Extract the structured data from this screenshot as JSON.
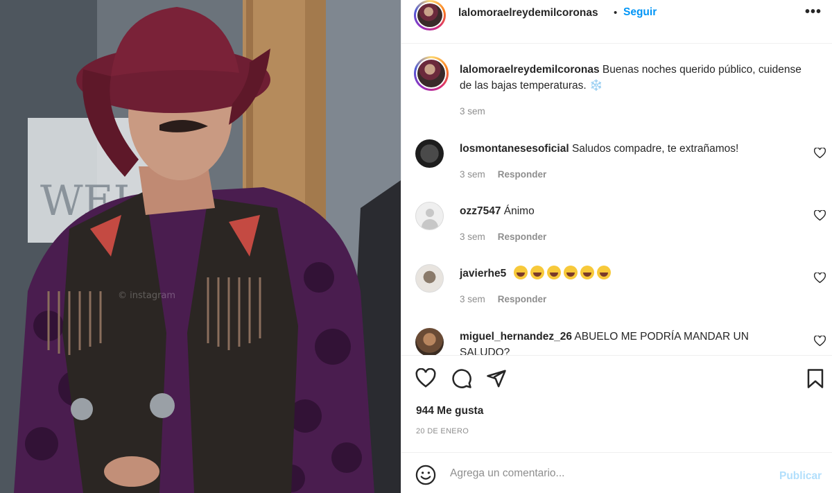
{
  "post": {
    "username": "lalomoraelreydemilcoronas",
    "follow_label": "Seguir",
    "separator": "•",
    "more_label": "•••",
    "caption_text": "Buenas noches querido público, cuidense de las bajas temperaturas. ❄️",
    "caption_time": "3 sem"
  },
  "photo": {
    "sign_text": "WELC",
    "watermark": "© instagram"
  },
  "comments": [
    {
      "username": "losmontanesesoficial",
      "text": "Saludos compadre, te extrañamos!",
      "time": "3 sem",
      "reply_label": "Responder"
    },
    {
      "username": "ozz7547",
      "text": "Ánimo",
      "time": "3 sem",
      "reply_label": "Responder"
    },
    {
      "username": "javierhe5",
      "text": "",
      "emoji_count": 6,
      "time": "3 sem",
      "reply_label": "Responder"
    },
    {
      "username": "miguel_hernandez_26",
      "text": "ABUELO ME PODRÍA MANDAR UN SALUDO?",
      "time": "",
      "reply_label": ""
    }
  ],
  "actions": {
    "likes": "944 Me gusta",
    "date": "20 DE ENERO"
  },
  "composer": {
    "placeholder": "Agrega un comentario...",
    "publish_label": "Publicar"
  },
  "colors": {
    "link": "#0095f6",
    "publish_disabled": "#b2dffc",
    "muted": "#8e8e8e",
    "hat": "#6e1e33",
    "shirt": "#4a1d4f"
  }
}
